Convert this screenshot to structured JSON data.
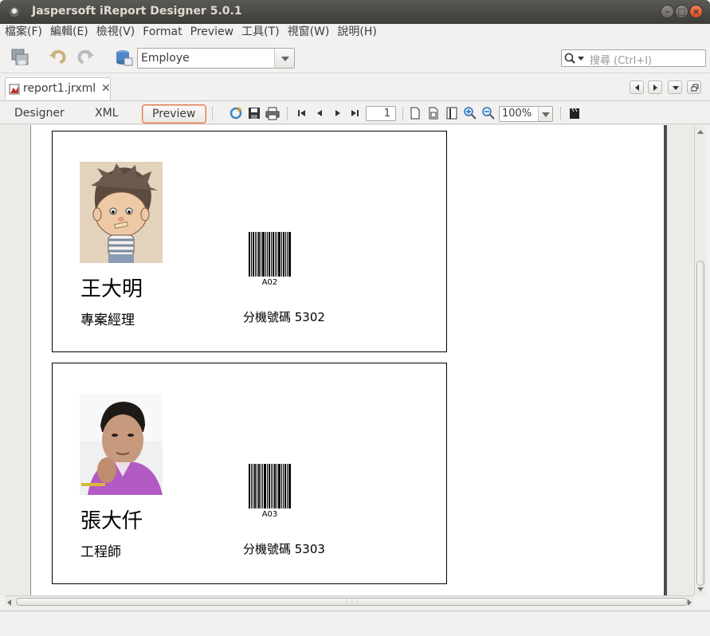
{
  "window": {
    "title": "Jaspersoft iReport Designer 5.0.1"
  },
  "menu": [
    "檔案(F)",
    "編輯(E)",
    "檢視(V)",
    "Format",
    "Preview",
    "工具(T)",
    "視窗(W)",
    "說明(H)"
  ],
  "toolbar": {
    "datasource_value": "Employe",
    "search_placeholder": "搜尋 (Ctrl+I)"
  },
  "editor_tab": {
    "label": "report1.jrxml",
    "close": "✕"
  },
  "view_tabs": {
    "designer": "Designer",
    "xml": "XML",
    "preview": "Preview",
    "active": "Preview"
  },
  "preview_toolbar": {
    "page": "1",
    "zoom": "100%"
  },
  "cards": [
    {
      "name": "王大明",
      "title": "專案經理",
      "extension": "分機號碼  5302",
      "barcode": "A02"
    },
    {
      "name": "張大仟",
      "title": "工程師",
      "extension": "分機號碼  5303",
      "barcode": "A03"
    }
  ]
}
